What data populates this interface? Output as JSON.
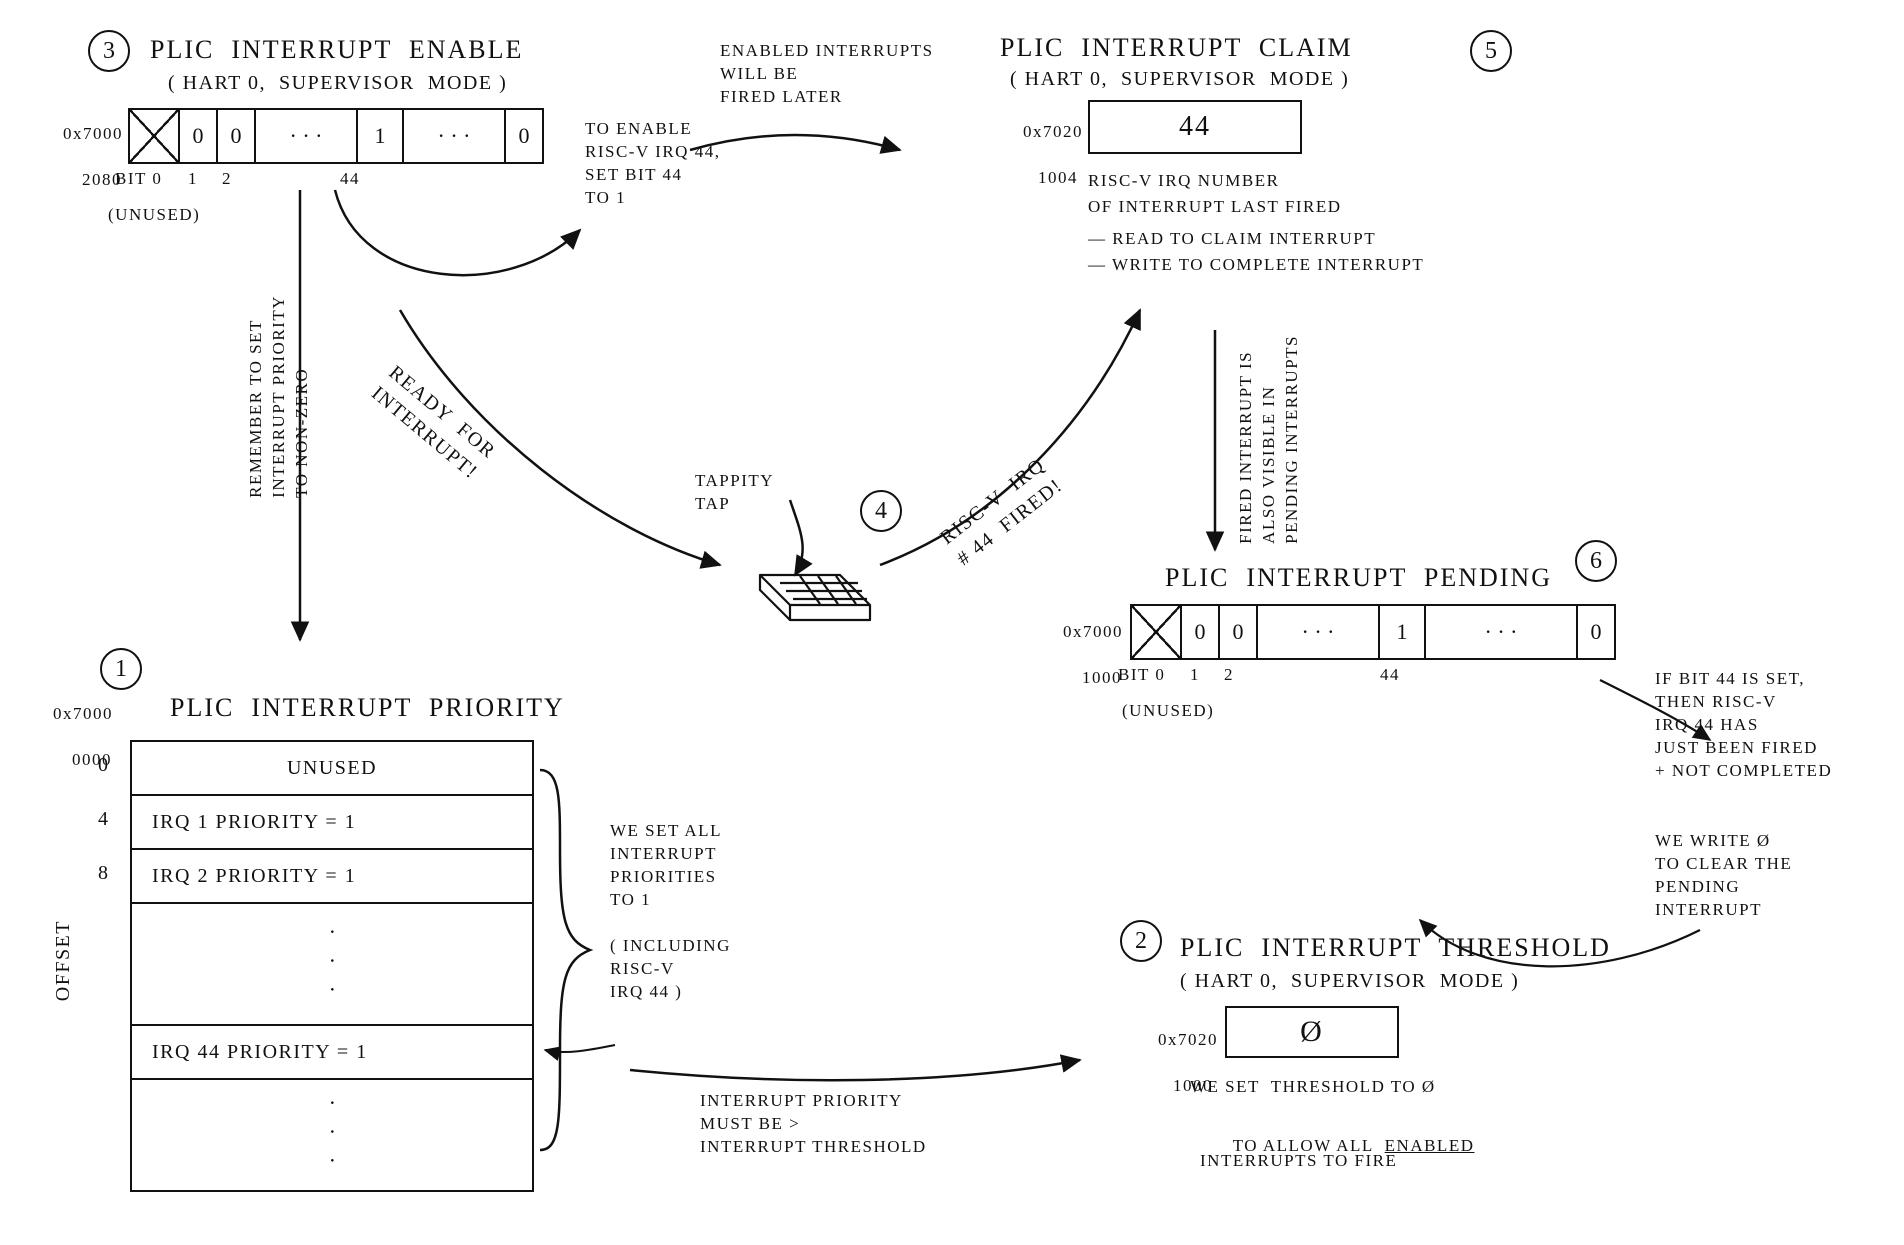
{
  "step_numbers": {
    "s1": "1",
    "s2": "2",
    "s3": "3",
    "s4": "4",
    "s5": "5",
    "s6": "6"
  },
  "enable": {
    "title": "PLIC  INTERRUPT  ENABLE",
    "subtitle": "( HART 0,  SUPERVISOR  MODE )",
    "addr_line1": "0x7000",
    "addr_line2": "2080",
    "cells": {
      "c0": "",
      "c1": "0",
      "c2": "0",
      "c3": "· · ·",
      "c4": "1",
      "c5": "· · ·",
      "c6": "0"
    },
    "bit_labels": {
      "b0": "BIT 0",
      "b1": "1",
      "b2": "2",
      "b44": "44"
    },
    "unused": "(UNUSED)",
    "side_note": "REMEMBER TO SET\nINTERRUPT PRIORITY\nTO NON-ZERO",
    "to_enable": "TO ENABLE\nRISC-V IRQ 44,\nSET BIT 44\nTO 1",
    "enabled_later": "ENABLED INTERRUPTS\nWILL BE\nFIRED LATER"
  },
  "claim": {
    "title": "PLIC  INTERRUPT  CLAIM",
    "subtitle": "( HART 0,  SUPERVISOR  MODE )",
    "addr_line1": "0x7020",
    "addr_line2": "1004",
    "value": "44",
    "desc1": "RISC-V IRQ NUMBER",
    "desc2": "OF INTERRUPT LAST FIRED",
    "desc3": "— READ TO CLAIM INTERRUPT",
    "desc4": "— WRITE TO COMPLETE INTERRUPT",
    "side_note": "FIRED INTERRUPT IS\nALSO VISIBLE IN\nPENDING INTERRUPTS"
  },
  "ready_label": "READY  FOR\nINTERRUPT!",
  "tappity": "TAPPITY\nTAP",
  "fired_label": "RISC-V  IRQ\n# 44  FIRED!",
  "pending": {
    "title": "PLIC  INTERRUPT  PENDING",
    "addr_line1": "0x7000",
    "addr_line2": "1000",
    "cells": {
      "c0": "",
      "c1": "0",
      "c2": "0",
      "c3": "· · ·",
      "c4": "1",
      "c5": "· · ·",
      "c6": "0"
    },
    "bit_labels": {
      "b0": "BIT 0",
      "b1": "1",
      "b2": "2",
      "b44": "44"
    },
    "unused": "(UNUSED)",
    "note_right1": "IF BIT 44 IS SET,\nTHEN RISC-V\nIRQ 44 HAS\nJUST BEEN FIRED\n+ NOT COMPLETED",
    "note_right2": "WE WRITE Ø\nTO CLEAR THE\nPENDING\nINTERRUPT"
  },
  "priority": {
    "title": "PLIC  INTERRUPT  PRIORITY",
    "addr_line1": "0x7000",
    "addr_line2": "0000",
    "offsets": {
      "o0": "0",
      "o4": "4",
      "o8": "8"
    },
    "offset_label": "OFFSET",
    "rows": {
      "r0": "UNUSED",
      "r1": "IRQ 1  PRIORITY  =  1",
      "r2": "IRQ 2  PRIORITY  =  1",
      "r44": "IRQ 44  PRIORITY  =  1"
    },
    "brace_note": "WE SET ALL\nINTERRUPT\nPRIORITIES\nTO  1\n\n( INCLUDING\nRISC-V\nIRQ 44 )",
    "bottom_note": "INTERRUPT PRIORITY\nMUST BE  >\nINTERRUPT THRESHOLD"
  },
  "threshold": {
    "title": "PLIC  INTERRUPT  THRESHOLD",
    "subtitle": "( HART 0,  SUPERVISOR  MODE )",
    "addr_line1": "0x7020",
    "addr_line2": "1000",
    "value": "Ø",
    "note_l1": "WE SET  THRESHOLD TO Ø",
    "note_l2": "TO ALLOW ALL  ",
    "enabled_word": "ENABLED",
    "note_l3": "INTERRUPTS TO FIRE"
  }
}
